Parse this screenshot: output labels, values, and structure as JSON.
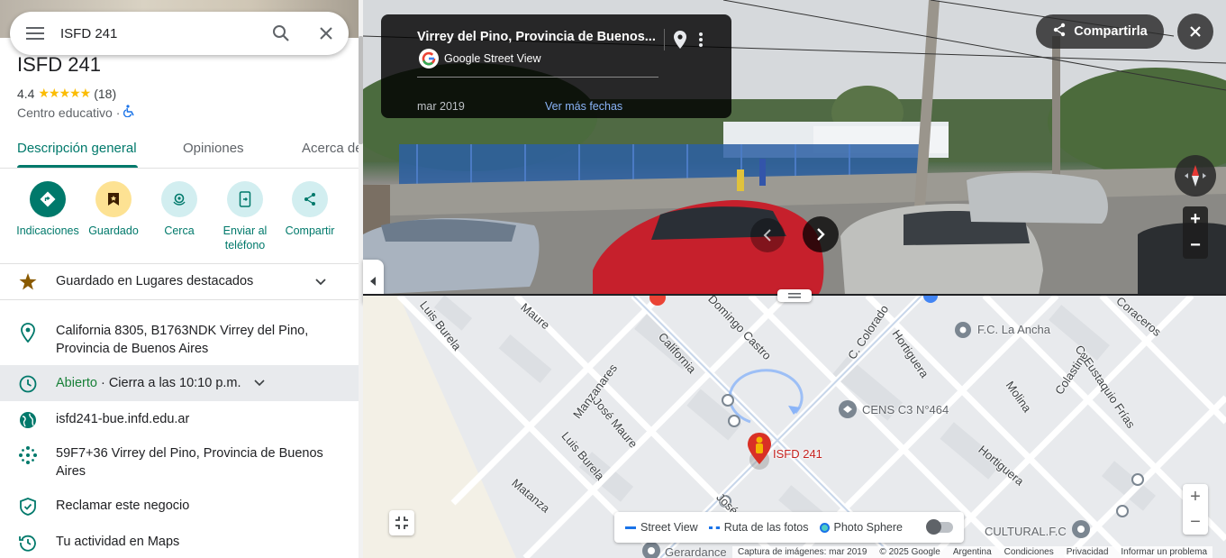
{
  "search": {
    "value": "ISFD 241"
  },
  "place": {
    "title": "ISFD 241",
    "rating": "4.4",
    "stars": "★★★★★",
    "review_count": "(18)",
    "category": "Centro educativo ·"
  },
  "tabs": [
    {
      "label": "Descripción general"
    },
    {
      "label": "Opiniones"
    },
    {
      "label": "Acerca de"
    }
  ],
  "actions": [
    {
      "label": "Indicaciones",
      "icon": "directions-icon"
    },
    {
      "label": "Guardado",
      "icon": "bookmark-icon"
    },
    {
      "label": "Cerca",
      "icon": "nearby-icon"
    },
    {
      "label": "Enviar al teléfono",
      "icon": "send-to-phone-icon"
    },
    {
      "label": "Compartir",
      "icon": "share-icon"
    }
  ],
  "saved_list": {
    "label": "Guardado en Lugares destacados"
  },
  "info": {
    "address": "California 8305, B1763NDK Virrey del Pino, Provincia de Buenos Aires",
    "hours_status": "Abierto",
    "hours_detail": " · Cierra a las 10:10 p.m.",
    "website": "isfd241-bue.infd.edu.ar",
    "plus_code": "59F7+36 Virrey del Pino, Provincia de Buenos Aires",
    "claim": "Reclamar este negocio",
    "activity": "Tu actividad en Maps"
  },
  "street_view": {
    "title": "Virrey del Pino, Provincia de Buenos...",
    "brand": "Google Street View",
    "date": "mar 2019",
    "more_dates": "Ver más fechas",
    "share_label": "Compartirla"
  },
  "map": {
    "streets": [
      "Luis Burela",
      "Maure",
      "California",
      "Domingo Castro",
      "C. Colorado",
      "Hortiguera",
      "F.C. La Ancha",
      "Colastine",
      "C. Eustaquio Frías",
      "Coraceros",
      "Manzanares",
      "José Maure",
      "Luis Burela",
      "Molina",
      "Hortiguera",
      "Matanza",
      "José"
    ],
    "pois": {
      "cens": "CENS C3 N°464",
      "place_marker": "ISFD 241",
      "cultural": "CULTURAL.F.C",
      "gerardance": "Gerardance"
    },
    "legend": {
      "street_view": "Street View",
      "photo_path": "Ruta de las fotos",
      "photo_sphere": "Photo Sphere"
    },
    "footer": [
      "Captura de imágenes: mar 2019",
      "© 2025 Google",
      "Argentina",
      "Condiciones",
      "Privacidad",
      "Informar un problema"
    ]
  },
  "colors": {
    "accent": "#00796b",
    "open": "#188038",
    "star": "#fbbc04",
    "marker": "#d93025",
    "link": "#8ab4f8"
  }
}
